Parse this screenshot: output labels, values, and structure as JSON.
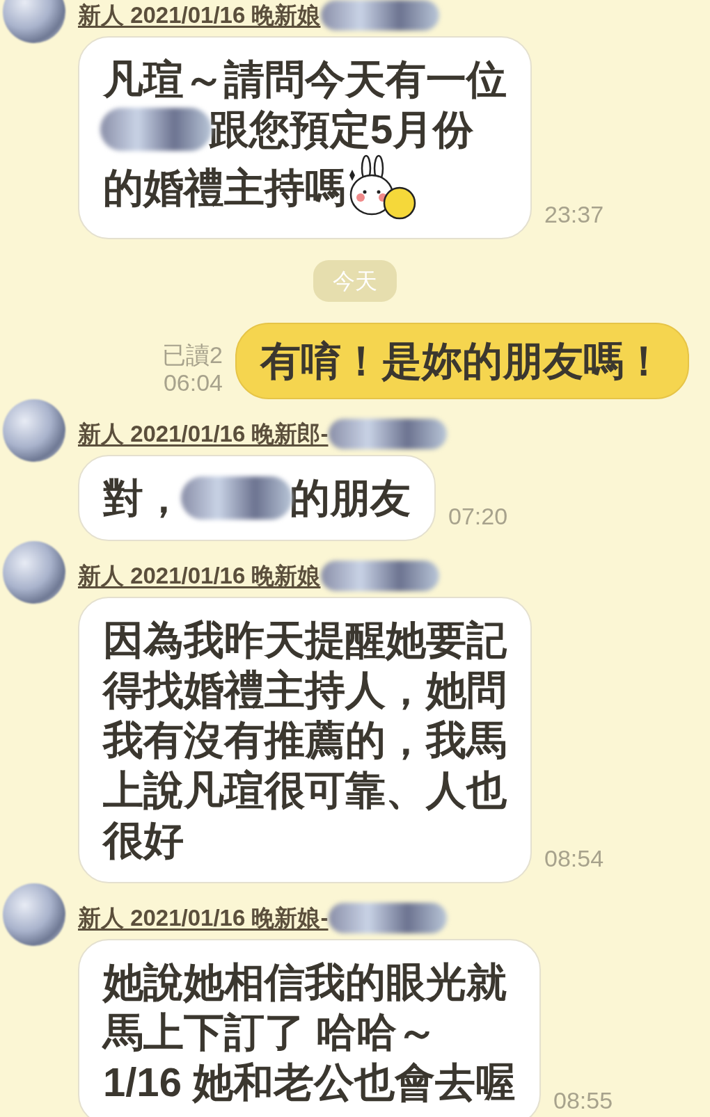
{
  "messages": [
    {
      "kind": "incoming",
      "sender": "新人 2021/01/16 晚新娘",
      "sender_blurred": true,
      "lines": [
        [
          {
            "kind": "text",
            "text": "凡瑄～請問今天有一位"
          }
        ],
        [
          {
            "kind": "blur"
          },
          {
            "kind": "text",
            "text": "跟您預定5月份"
          }
        ],
        [
          {
            "kind": "text",
            "text": "的婚禮主持嗎"
          },
          {
            "kind": "sticker"
          }
        ]
      ],
      "time": "23:37"
    },
    {
      "kind": "date",
      "label": "今天"
    },
    {
      "kind": "outgoing",
      "read": "已讀2",
      "time": "06:04",
      "lines": [
        [
          {
            "kind": "text",
            "text": "有唷！是妳的朋友嗎！"
          }
        ]
      ]
    },
    {
      "kind": "incoming",
      "sender": "新人 2021/01/16 晚新郎-",
      "sender_blurred": true,
      "lines": [
        [
          {
            "kind": "text",
            "text": "對，"
          },
          {
            "kind": "blur"
          },
          {
            "kind": "text",
            "text": "的朋友"
          }
        ]
      ],
      "time": "07:20"
    },
    {
      "kind": "incoming",
      "sender": "新人 2021/01/16 晚新娘",
      "sender_blurred": true,
      "lines": [
        [
          {
            "kind": "text",
            "text": "因為我昨天提醒她要記"
          }
        ],
        [
          {
            "kind": "text",
            "text": "得找婚禮主持人，她問"
          }
        ],
        [
          {
            "kind": "text",
            "text": "我有沒有推薦的，我馬"
          }
        ],
        [
          {
            "kind": "text",
            "text": "上說凡瑄很可靠、人也"
          }
        ],
        [
          {
            "kind": "text",
            "text": "很好"
          }
        ]
      ],
      "time": "08:54"
    },
    {
      "kind": "incoming",
      "sender": "新人 2021/01/16 晚新娘-",
      "sender_blurred": true,
      "lines": [
        [
          {
            "kind": "text",
            "text": "她說她相信我的眼光就"
          }
        ],
        [
          {
            "kind": "text",
            "text": "馬上下訂了 哈哈～"
          }
        ],
        [
          {
            "kind": "text",
            "text": "1/16 她和老公也會去喔"
          }
        ]
      ],
      "time": "08:55"
    }
  ]
}
